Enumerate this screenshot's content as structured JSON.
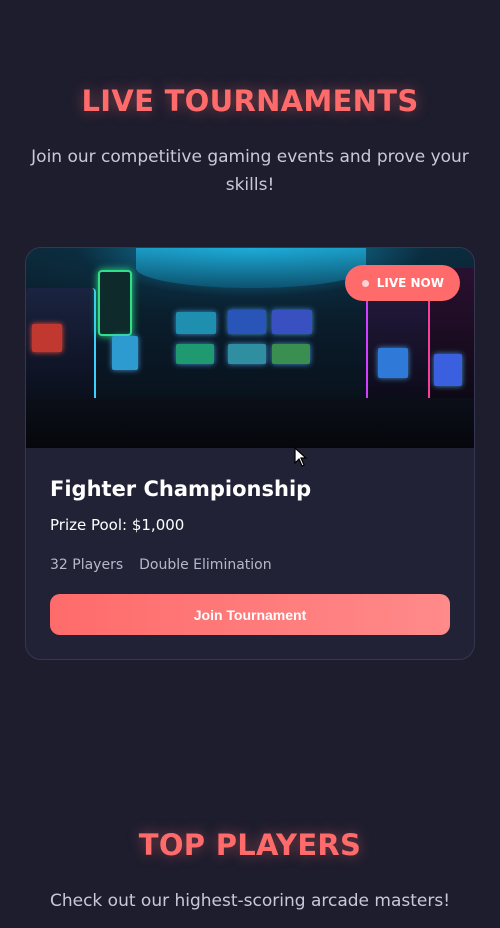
{
  "tournaments_section": {
    "title": "LIVE TOURNAMENTS",
    "subtitle": "Join our competitive gaming events and prove your skills!"
  },
  "tournament_card": {
    "badge": "LIVE NOW",
    "title": "Fighter Championship",
    "prize": "Prize Pool: $1,000",
    "players": "32 Players",
    "format": "Double Elimination",
    "button_label": "Join Tournament",
    "image_icon": "arcade-room-photo"
  },
  "players_section": {
    "title": "TOP PLAYERS",
    "subtitle": "Check out our highest-scoring arcade masters!"
  },
  "colors": {
    "background": "#1d1d2e",
    "card": "#222236",
    "accent": "#ff6b6b",
    "muted_text": "#c9c9d6"
  }
}
